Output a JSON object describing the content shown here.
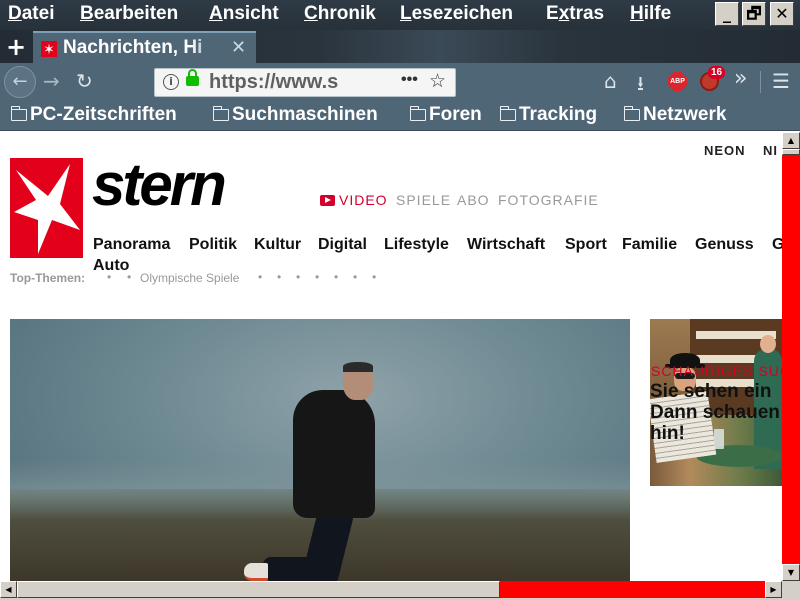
{
  "menubar": {
    "items": [
      {
        "first": "D",
        "rest": "atei"
      },
      {
        "first": "B",
        "rest": "earbeiten"
      },
      {
        "first": "A",
        "rest": "nsicht"
      },
      {
        "first": "C",
        "rest": "hronik"
      },
      {
        "first": "L",
        "rest": "esezeichen"
      },
      {
        "first": "E",
        "rest": "xtras",
        "acc_pos": 1
      },
      {
        "first": "H",
        "rest": "ilfe"
      }
    ],
    "window_buttons": [
      "_",
      "🗗",
      "✕"
    ]
  },
  "tabbar": {
    "new_tab_label": "+",
    "tab": {
      "title": "Nachrichten, Hi",
      "close": "✕"
    }
  },
  "navbar": {
    "back": "←",
    "forward": "→",
    "reload": "↻",
    "url": "https://www.s",
    "page_actions": "•••",
    "bookmark_star": "☆",
    "home": "⌂",
    "download": "⭳",
    "abp_label": "ABP",
    "ext_badge": "16",
    "overflow": "»",
    "menu": "☰"
  },
  "bookmarks": [
    {
      "label": "PC-Zeitschriften"
    },
    {
      "label": "Suchmaschinen"
    },
    {
      "label": "Foren"
    },
    {
      "label": "Tracking"
    },
    {
      "label": "Netzwerk"
    }
  ],
  "site": {
    "wordmark": "stern",
    "top_right_links": [
      "NEON",
      "NI"
    ],
    "secondary_nav": {
      "video": "VIDEO",
      "items": [
        "SPIELE",
        "ABO",
        "FOTOGRAFIE"
      ]
    },
    "main_nav": [
      "Panorama",
      "Politik",
      "Kultur",
      "Digital",
      "Lifestyle",
      "Wirtschaft",
      "Sport",
      "Familie",
      "Genuss",
      "G",
      "Auto"
    ],
    "top_themen": {
      "label": "Top-Themen:",
      "items": [
        "Olympische Spiele"
      ]
    },
    "side_teaser": {
      "kicker": "SCHAURIGES SUCH",
      "headline": "Sie sehen ein\nDann schauen\nhin!"
    }
  },
  "scrollbars": {
    "up": "▲",
    "down": "▼",
    "left": "◀",
    "right": "▶",
    "track_color": "#fe0000"
  },
  "colors": {
    "brand_red": "#e2001a",
    "chrome_dark": "#2e3a45",
    "chrome_mid": "#4f6677"
  }
}
